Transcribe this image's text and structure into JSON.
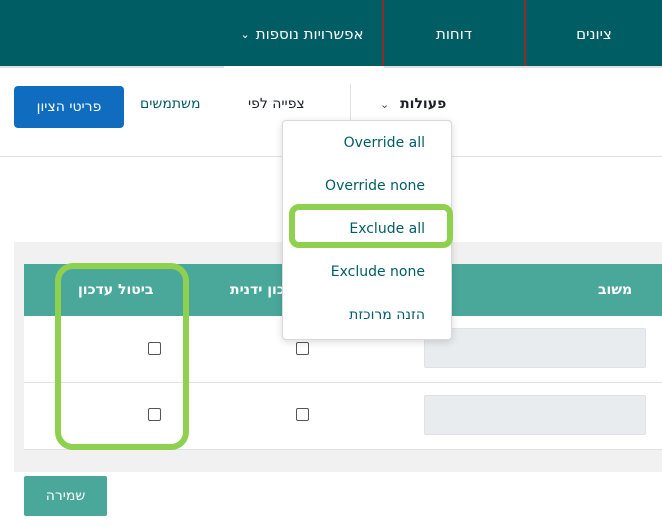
{
  "topnav": {
    "tabs": [
      {
        "label": "ציונים"
      },
      {
        "label": "דוחות"
      },
      {
        "label": "אפשרויות נוספות"
      }
    ],
    "caret": "⌄"
  },
  "subbar": {
    "primary_button": "פריטי הציון",
    "users_link": "משתמשים",
    "view_by": "צפייה לפי",
    "actions": "פעולות",
    "actions_caret": "⌄"
  },
  "dropdown": {
    "items": [
      "Override all",
      "Override none",
      "Exclude all",
      "Exclude none",
      "הזנה מרוכזת"
    ]
  },
  "table": {
    "headers": [
      "משוב",
      "עדכון ידנית",
      "ביטול עדכון"
    ],
    "rows": 2
  },
  "save_button": "שמירה",
  "colors": {
    "nav": "#005d64",
    "table_header": "#4aa89a",
    "primary": "#0f6cbf",
    "highlight": "#8fd14f"
  }
}
